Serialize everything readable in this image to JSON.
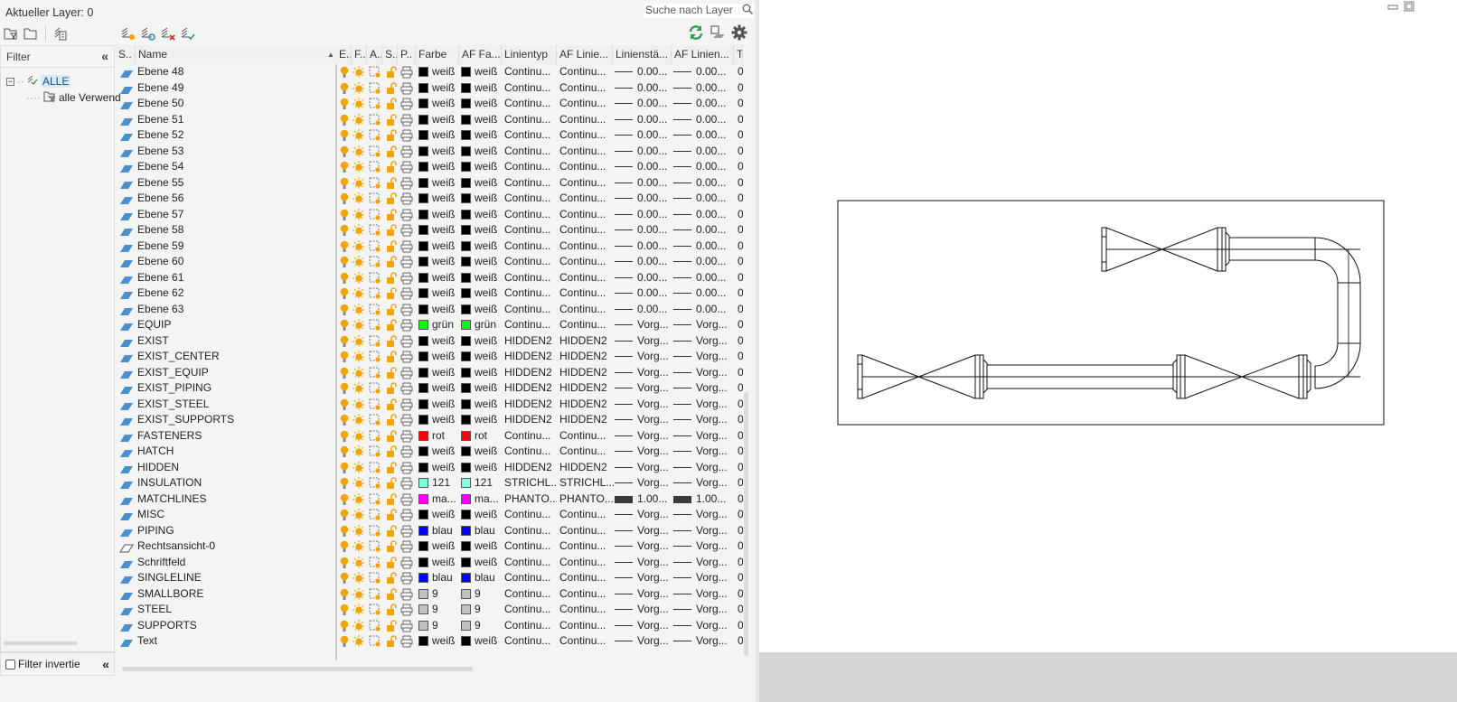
{
  "header": {
    "current_layer": "Aktueller Layer: 0",
    "search_placeholder": "Suche nach Layer"
  },
  "toolbar": {
    "left_icons": [
      "new-property-filter-icon",
      "new-group-filter-icon",
      "layer-states-icon"
    ],
    "mid_icons": [
      "new-layer-icon",
      "new-layer-vp-frozen-icon",
      "delete-layer-icon",
      "set-current-icon"
    ],
    "right_icons": [
      "refresh-icon",
      "settings-toggle-icon",
      "gear-icon"
    ]
  },
  "filter": {
    "title": "Filter",
    "collapse": "«",
    "tree": [
      {
        "label": "ALLE"
      },
      {
        "label": "alle Verwend"
      }
    ],
    "invert_label": "Filter invertie",
    "invert_checked": false
  },
  "columns": [
    "S..",
    "Name",
    "E..",
    "F..",
    "A..",
    "S..",
    "P..",
    "Farbe",
    "AF Fa...",
    "Linientyp",
    "AF Linie...",
    "Linienstä...",
    "AF Linien...",
    "T"
  ],
  "rows": [
    {
      "name": "Ebene 48",
      "color_name": "weiß",
      "color": "#000000",
      "linetype": "Continu...",
      "af_linetype": "Continu...",
      "lw": "0.00...",
      "af_lw": "0.00...",
      "t": "0"
    },
    {
      "name": "Ebene 49",
      "color_name": "weiß",
      "color": "#000000",
      "linetype": "Continu...",
      "af_linetype": "Continu...",
      "lw": "0.00...",
      "af_lw": "0.00...",
      "t": "0"
    },
    {
      "name": "Ebene 50",
      "color_name": "weiß",
      "color": "#000000",
      "linetype": "Continu...",
      "af_linetype": "Continu...",
      "lw": "0.00...",
      "af_lw": "0.00...",
      "t": "0"
    },
    {
      "name": "Ebene 51",
      "color_name": "weiß",
      "color": "#000000",
      "linetype": "Continu...",
      "af_linetype": "Continu...",
      "lw": "0.00...",
      "af_lw": "0.00...",
      "t": "0"
    },
    {
      "name": "Ebene 52",
      "color_name": "weiß",
      "color": "#000000",
      "linetype": "Continu...",
      "af_linetype": "Continu...",
      "lw": "0.00...",
      "af_lw": "0.00...",
      "t": "0"
    },
    {
      "name": "Ebene 53",
      "color_name": "weiß",
      "color": "#000000",
      "linetype": "Continu...",
      "af_linetype": "Continu...",
      "lw": "0.00...",
      "af_lw": "0.00...",
      "t": "0"
    },
    {
      "name": "Ebene 54",
      "color_name": "weiß",
      "color": "#000000",
      "linetype": "Continu...",
      "af_linetype": "Continu...",
      "lw": "0.00...",
      "af_lw": "0.00...",
      "t": "0"
    },
    {
      "name": "Ebene 55",
      "color_name": "weiß",
      "color": "#000000",
      "linetype": "Continu...",
      "af_linetype": "Continu...",
      "lw": "0.00...",
      "af_lw": "0.00...",
      "t": "0"
    },
    {
      "name": "Ebene 56",
      "color_name": "weiß",
      "color": "#000000",
      "linetype": "Continu...",
      "af_linetype": "Continu...",
      "lw": "0.00...",
      "af_lw": "0.00...",
      "t": "0"
    },
    {
      "name": "Ebene 57",
      "color_name": "weiß",
      "color": "#000000",
      "linetype": "Continu...",
      "af_linetype": "Continu...",
      "lw": "0.00...",
      "af_lw": "0.00...",
      "t": "0"
    },
    {
      "name": "Ebene 58",
      "color_name": "weiß",
      "color": "#000000",
      "linetype": "Continu...",
      "af_linetype": "Continu...",
      "lw": "0.00...",
      "af_lw": "0.00...",
      "t": "0"
    },
    {
      "name": "Ebene 59",
      "color_name": "weiß",
      "color": "#000000",
      "linetype": "Continu...",
      "af_linetype": "Continu...",
      "lw": "0.00...",
      "af_lw": "0.00...",
      "t": "0"
    },
    {
      "name": "Ebene 60",
      "color_name": "weiß",
      "color": "#000000",
      "linetype": "Continu...",
      "af_linetype": "Continu...",
      "lw": "0.00...",
      "af_lw": "0.00...",
      "t": "0"
    },
    {
      "name": "Ebene 61",
      "color_name": "weiß",
      "color": "#000000",
      "linetype": "Continu...",
      "af_linetype": "Continu...",
      "lw": "0.00...",
      "af_lw": "0.00...",
      "t": "0"
    },
    {
      "name": "Ebene 62",
      "color_name": "weiß",
      "color": "#000000",
      "linetype": "Continu...",
      "af_linetype": "Continu...",
      "lw": "0.00...",
      "af_lw": "0.00...",
      "t": "0"
    },
    {
      "name": "Ebene 63",
      "color_name": "weiß",
      "color": "#000000",
      "linetype": "Continu...",
      "af_linetype": "Continu...",
      "lw": "0.00...",
      "af_lw": "0.00...",
      "t": "0"
    },
    {
      "name": "EQUIP",
      "color_name": "grün",
      "color": "#00ff00",
      "linetype": "Continu...",
      "af_linetype": "Continu...",
      "lw": "Vorg...",
      "af_lw": "Vorg...",
      "t": "0"
    },
    {
      "name": "EXIST",
      "color_name": "weiß",
      "color": "#000000",
      "linetype": "HIDDEN2",
      "af_linetype": "HIDDEN2",
      "lw": "Vorg...",
      "af_lw": "Vorg...",
      "t": "0"
    },
    {
      "name": "EXIST_CENTER",
      "color_name": "weiß",
      "color": "#000000",
      "linetype": "HIDDEN2",
      "af_linetype": "HIDDEN2",
      "lw": "Vorg...",
      "af_lw": "Vorg...",
      "t": "0"
    },
    {
      "name": "EXIST_EQUIP",
      "color_name": "weiß",
      "color": "#000000",
      "linetype": "HIDDEN2",
      "af_linetype": "HIDDEN2",
      "lw": "Vorg...",
      "af_lw": "Vorg...",
      "t": "0"
    },
    {
      "name": "EXIST_PIPING",
      "color_name": "weiß",
      "color": "#000000",
      "linetype": "HIDDEN2",
      "af_linetype": "HIDDEN2",
      "lw": "Vorg...",
      "af_lw": "Vorg...",
      "t": "0"
    },
    {
      "name": "EXIST_STEEL",
      "color_name": "weiß",
      "color": "#000000",
      "linetype": "HIDDEN2",
      "af_linetype": "HIDDEN2",
      "lw": "Vorg...",
      "af_lw": "Vorg...",
      "t": "0"
    },
    {
      "name": "EXIST_SUPPORTS",
      "color_name": "weiß",
      "color": "#000000",
      "linetype": "HIDDEN2",
      "af_linetype": "HIDDEN2",
      "lw": "Vorg...",
      "af_lw": "Vorg...",
      "t": "0"
    },
    {
      "name": "FASTENERS",
      "color_name": "rot",
      "color": "#ff0000",
      "linetype": "Continu...",
      "af_linetype": "Continu...",
      "lw": "Vorg...",
      "af_lw": "Vorg...",
      "t": "0"
    },
    {
      "name": "HATCH",
      "color_name": "weiß",
      "color": "#000000",
      "linetype": "Continu...",
      "af_linetype": "Continu...",
      "lw": "Vorg...",
      "af_lw": "Vorg...",
      "t": "0"
    },
    {
      "name": "HIDDEN",
      "color_name": "weiß",
      "color": "#000000",
      "linetype": "HIDDEN2",
      "af_linetype": "HIDDEN2",
      "lw": "Vorg...",
      "af_lw": "Vorg...",
      "t": "0"
    },
    {
      "name": "INSULATION",
      "color_name": "121",
      "color": "#80ffdf",
      "linetype": "STRICHL...",
      "af_linetype": "STRICHL...",
      "lw": "Vorg...",
      "af_lw": "Vorg...",
      "t": "0"
    },
    {
      "name": "MATCHLINES",
      "color_name": "ma...",
      "color": "#ff00ff",
      "linetype": "PHANTO...",
      "af_linetype": "PHANTO...",
      "lw": "1.00...",
      "af_lw": "1.00...",
      "thick": true,
      "t": "0"
    },
    {
      "name": "MISC",
      "color_name": "weiß",
      "color": "#000000",
      "linetype": "Continu...",
      "af_linetype": "Continu...",
      "lw": "Vorg...",
      "af_lw": "Vorg...",
      "t": "0"
    },
    {
      "name": "PIPING",
      "color_name": "blau",
      "color": "#0000ff",
      "linetype": "Continu...",
      "af_linetype": "Continu...",
      "lw": "Vorg...",
      "af_lw": "Vorg...",
      "t": "0"
    },
    {
      "name": "Rechtsansicht-0",
      "color_name": "weiß",
      "color": "#000000",
      "linetype": "Continu...",
      "af_linetype": "Continu...",
      "lw": "Vorg...",
      "af_lw": "Vorg...",
      "outline": true,
      "t": "0"
    },
    {
      "name": "Schriftfeld",
      "color_name": "weiß",
      "color": "#000000",
      "linetype": "Continu...",
      "af_linetype": "Continu...",
      "lw": "Vorg...",
      "af_lw": "Vorg...",
      "t": "0"
    },
    {
      "name": "SINGLELINE",
      "color_name": "blau",
      "color": "#0000ff",
      "linetype": "Continu...",
      "af_linetype": "Continu...",
      "lw": "Vorg...",
      "af_lw": "Vorg...",
      "t": "0"
    },
    {
      "name": "SMALLBORE",
      "color_name": "9",
      "color": "#c0c0c0",
      "linetype": "Continu...",
      "af_linetype": "Continu...",
      "lw": "Vorg...",
      "af_lw": "Vorg...",
      "t": "0"
    },
    {
      "name": "STEEL",
      "color_name": "9",
      "color": "#c0c0c0",
      "linetype": "Continu...",
      "af_linetype": "Continu...",
      "lw": "Vorg...",
      "af_lw": "Vorg...",
      "t": "0"
    },
    {
      "name": "SUPPORTS",
      "color_name": "9",
      "color": "#c0c0c0",
      "linetype": "Continu...",
      "af_linetype": "Continu...",
      "lw": "Vorg...",
      "af_lw": "Vorg...",
      "t": "0"
    },
    {
      "name": "Text",
      "color_name": "weiß",
      "color": "#000000",
      "linetype": "Continu...",
      "af_linetype": "Continu...",
      "lw": "Vorg...",
      "af_lw": "Vorg...",
      "t": "0"
    }
  ]
}
